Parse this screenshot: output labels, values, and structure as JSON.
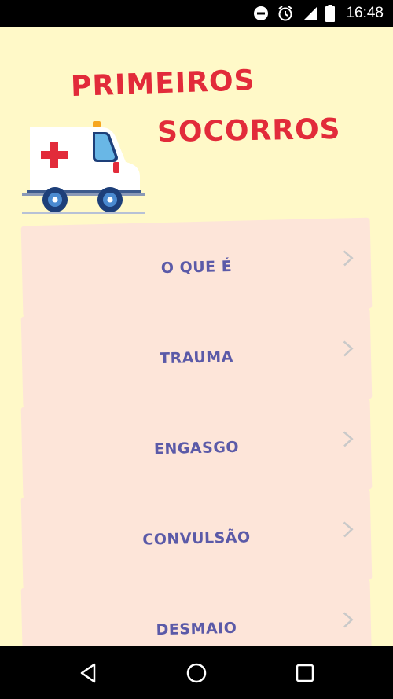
{
  "status_bar": {
    "time": "16:48",
    "icons": [
      "do-not-disturb-icon",
      "alarm-icon",
      "signal-icon",
      "battery-icon"
    ]
  },
  "header": {
    "title_line1": "PRIMEIROS",
    "title_line2": "SOCORROS",
    "logo": "ambulance-icon"
  },
  "menu": {
    "items": [
      {
        "label": "O QUE É"
      },
      {
        "label": "TRAUMA"
      },
      {
        "label": "ENGASGO"
      },
      {
        "label": "CONVULSÃO"
      },
      {
        "label": "DESMAIO"
      }
    ]
  },
  "colors": {
    "background": "#fff9c8",
    "card": "#fde5d9",
    "card_text": "#5b5aa8",
    "title": "#e22b3a"
  },
  "nav_bar": {
    "icons": [
      "back-icon",
      "home-icon",
      "recents-icon"
    ]
  }
}
